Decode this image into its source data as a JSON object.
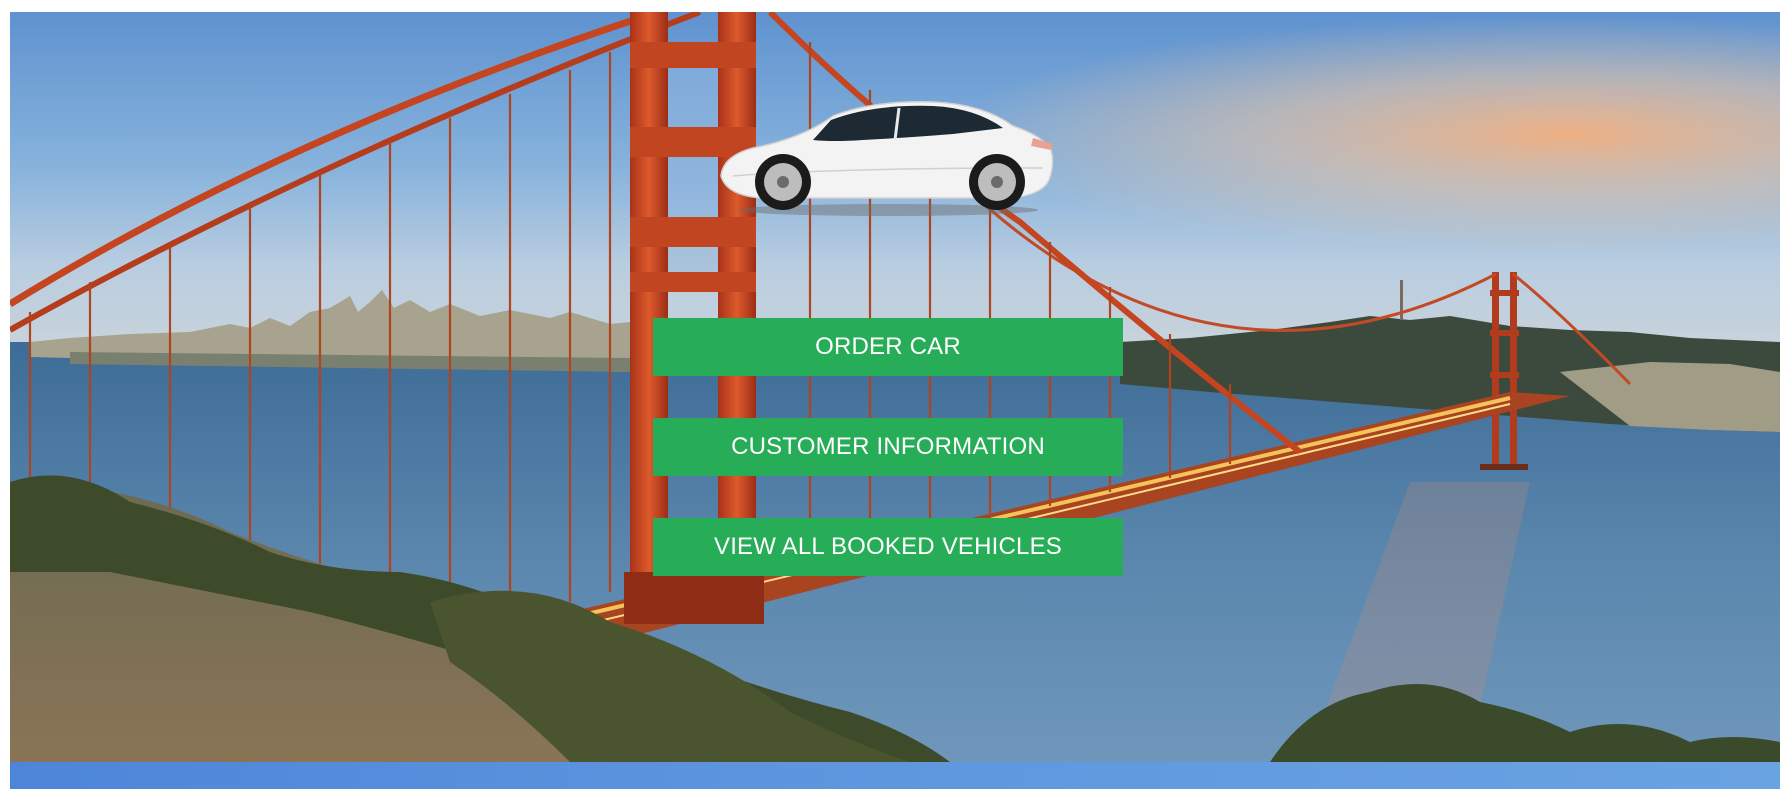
{
  "menu": {
    "order_car_label": "ORDER CAR",
    "customer_information_label": "CUSTOMER INFORMATION",
    "view_booked_label": "VIEW ALL BOOKED VEHICLES"
  },
  "colors": {
    "button_green": "#27ad58",
    "button_text": "#ffffff",
    "footer_band": "#5f97df",
    "bridge_orange": "#c8401f"
  },
  "icons": {
    "hero_image": "golden-gate-bridge-image",
    "car_image": "white-sedan-car-icon"
  }
}
